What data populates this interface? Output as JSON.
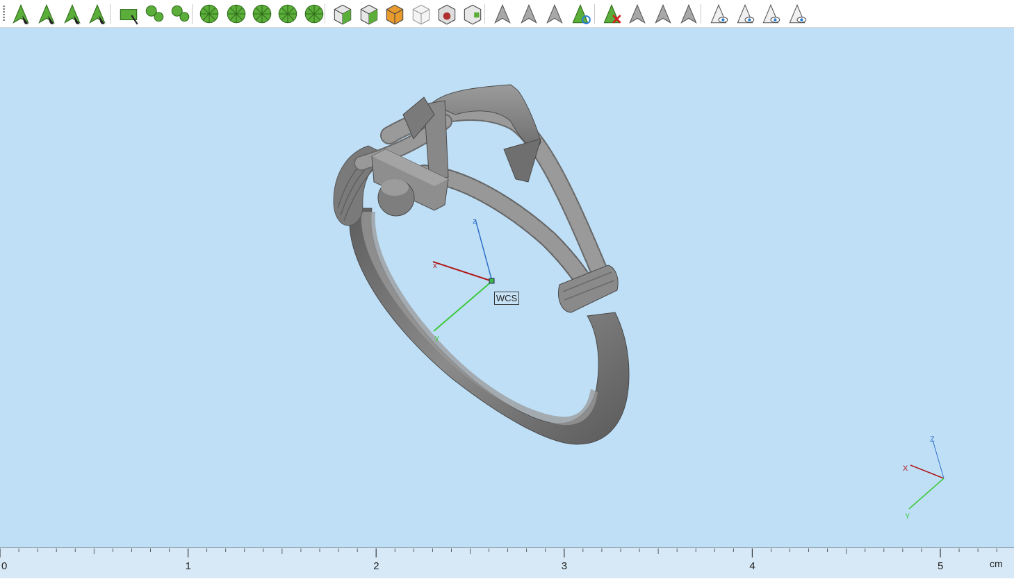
{
  "toolbar": {
    "buttons": [
      {
        "name": "select-point-icon",
        "group": "select"
      },
      {
        "name": "select-surface-icon",
        "group": "select"
      },
      {
        "name": "select-curve-icon",
        "group": "select"
      },
      {
        "name": "select-solid-icon",
        "group": "select"
      },
      {
        "name": "face-box-icon",
        "group": "face"
      },
      {
        "name": "face-blob-icon",
        "group": "face"
      },
      {
        "name": "face-curve-icon",
        "group": "face"
      },
      {
        "name": "mesh-facets-icon",
        "group": "mesh"
      },
      {
        "name": "mesh-blobs-icon",
        "group": "mesh"
      },
      {
        "name": "mesh-star-icon",
        "group": "mesh"
      },
      {
        "name": "mesh-wheel-icon",
        "group": "mesh"
      },
      {
        "name": "mesh-sector-icon",
        "group": "mesh"
      },
      {
        "name": "cube-shaded-icon",
        "group": "view"
      },
      {
        "name": "cube-solid-icon",
        "group": "view"
      },
      {
        "name": "cube-orange-icon",
        "group": "view"
      },
      {
        "name": "cube-wire-icon",
        "group": "view"
      },
      {
        "name": "cube-red-icon",
        "group": "view"
      },
      {
        "name": "cube-green-icon",
        "group": "view"
      },
      {
        "name": "object-select-icon",
        "group": "object"
      },
      {
        "name": "object-multi-select-icon",
        "group": "object"
      },
      {
        "name": "object-feature-select-icon",
        "group": "object"
      },
      {
        "name": "object-refresh-icon",
        "group": "object"
      },
      {
        "name": "object-delete-icon",
        "group": "edit"
      },
      {
        "name": "object-split-icon",
        "group": "edit"
      },
      {
        "name": "object-copy-icon",
        "group": "edit"
      },
      {
        "name": "object-paste-icon",
        "group": "edit"
      },
      {
        "name": "object-hide-icon",
        "group": "vis"
      },
      {
        "name": "object-show-icon",
        "group": "vis"
      },
      {
        "name": "object-eye-icon",
        "group": "vis"
      },
      {
        "name": "object-hide-all-icon",
        "group": "vis"
      }
    ]
  },
  "viewport": {
    "background": "#bfdff6",
    "model_color": "#7a7a7a",
    "wcs": {
      "label": "WCS",
      "x_label": "x",
      "y_label": "y",
      "z_label": "z",
      "x_color": "#b01818",
      "y_color": "#3cc83c",
      "z_color": "#2f6fc8"
    },
    "triad": {
      "x_label": "X",
      "y_label": "Y",
      "z_label": "Z"
    }
  },
  "ruler": {
    "unit": "cm",
    "labels": [
      "0",
      "1",
      "2",
      "3",
      "4",
      "5"
    ]
  }
}
